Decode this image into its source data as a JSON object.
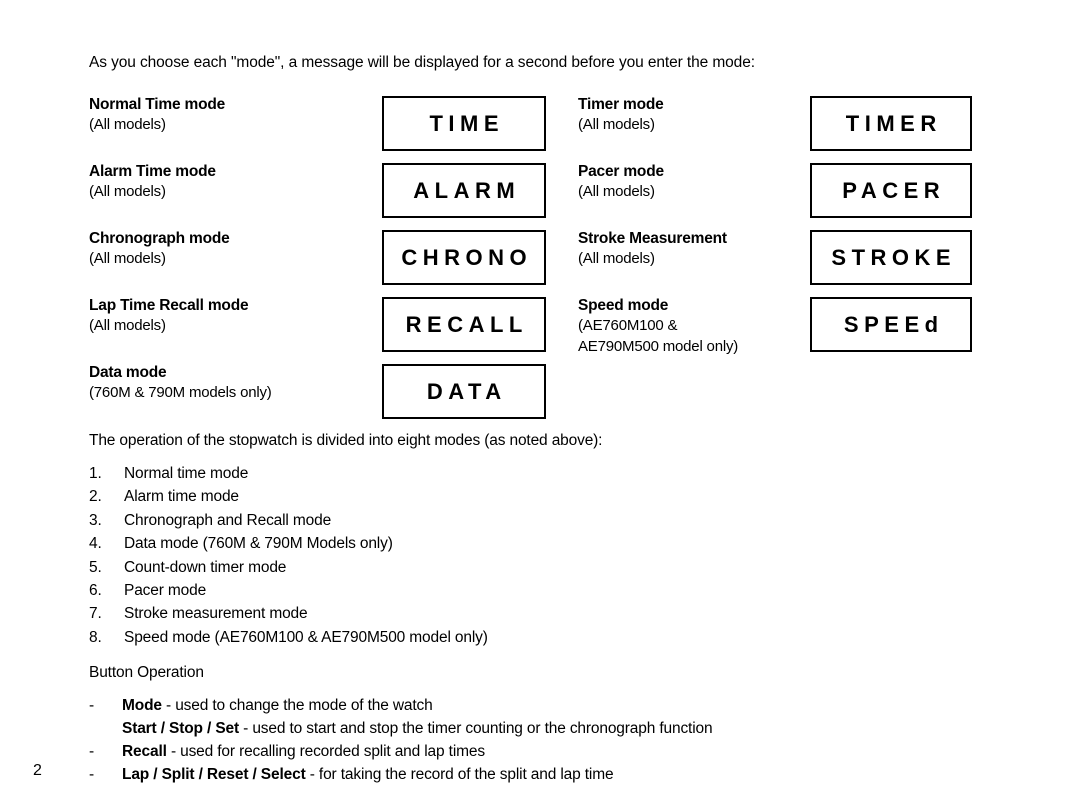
{
  "document": {
    "page_number": "2",
    "intro": "As you choose each \"mode\", a message will be displayed for a second before you enter the mode:",
    "operation_intro": "The operation of the stopwatch is divided into eight modes (as noted above):",
    "button_operation_heading": "Button Operation"
  },
  "modes": {
    "left_column": [
      {
        "title": "Normal Time mode",
        "models": "(All models)",
        "models_line2": "",
        "display": "TIME"
      },
      {
        "title": "Alarm Time mode",
        "models": "(All models)",
        "models_line2": "",
        "display": "ALARM"
      },
      {
        "title": "Chronograph mode",
        "models": "(All models)",
        "models_line2": "",
        "display": "CHRONO"
      },
      {
        "title": "Lap Time Recall mode",
        "models": "(All models)",
        "models_line2": "",
        "display": "RECALL"
      },
      {
        "title": "Data mode",
        "models": "(760M & 790M models only)",
        "models_line2": "",
        "display": "DATA"
      }
    ],
    "right_column": [
      {
        "title": "Timer mode",
        "models": "(All models)",
        "models_line2": "",
        "display": "TIMER"
      },
      {
        "title": "Pacer mode",
        "models": "(All models)",
        "models_line2": "",
        "display": "PACER"
      },
      {
        "title": "Stroke Measurement",
        "models": "(All models)",
        "models_line2": "",
        "display": "STROKE"
      },
      {
        "title": "Speed mode",
        "models": "(AE760M100 &",
        "models_line2": "AE790M500 model only)",
        "display": "SPEEd"
      }
    ]
  },
  "mode_list": [
    {
      "num": "1.",
      "text": "Normal time mode"
    },
    {
      "num": "2.",
      "text": "Alarm time mode"
    },
    {
      "num": "3.",
      "text": "Chronograph and Recall mode"
    },
    {
      "num": "4.",
      "text": "Data mode (760M & 790M Models only)"
    },
    {
      "num": "5.",
      "text": "Count-down timer mode"
    },
    {
      "num": "6.",
      "text": "Pacer mode"
    },
    {
      "num": "7.",
      "text": "Stroke measurement mode"
    },
    {
      "num": "8.",
      "text": "Speed mode (AE760M100 & AE790M500 model only)"
    }
  ],
  "button_operation": [
    {
      "dash": "-",
      "button": "Mode",
      "desc": " - used to change the mode of the watch"
    },
    {
      "dash": "",
      "button": "Start / Stop / Set",
      "desc": " - used to start and stop the timer counting or the chronograph function"
    },
    {
      "dash": "-",
      "button": "Recall",
      "desc": " - used for recalling recorded split and lap times"
    },
    {
      "dash": "-",
      "button": "Lap / Split / Reset / Select",
      "desc": " - for taking the record of the split and lap time"
    }
  ],
  "colors": {
    "text": "#000000",
    "background": "#ffffff",
    "box_border": "#000000"
  }
}
